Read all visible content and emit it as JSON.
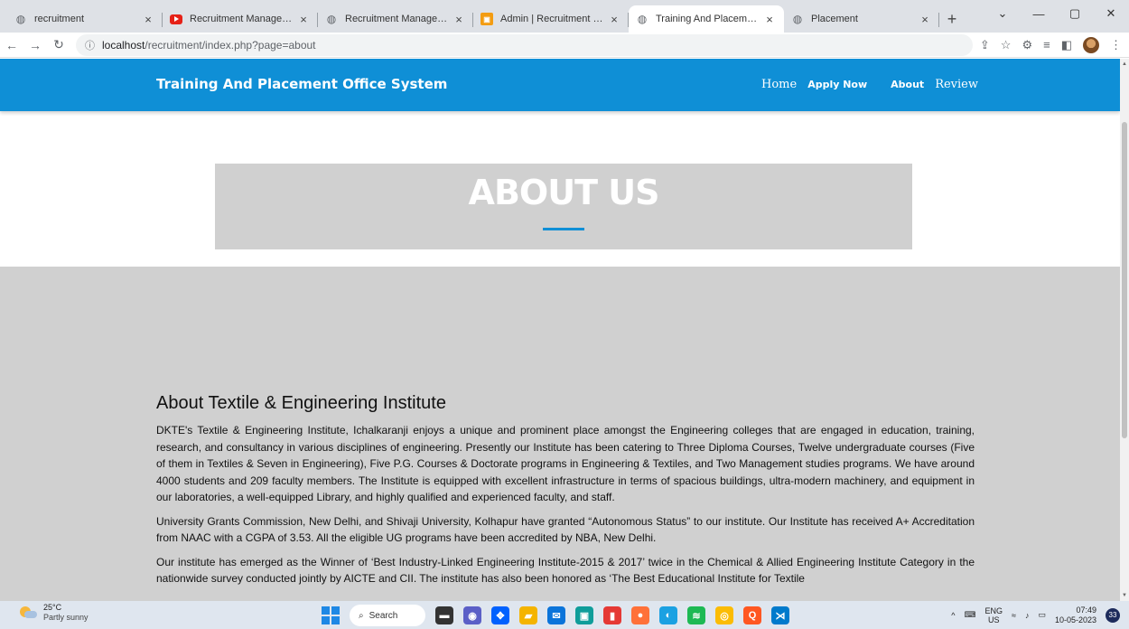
{
  "browser": {
    "tabs": [
      {
        "title": "recruitment",
        "icon": "globe-icon",
        "active": false
      },
      {
        "title": "Recruitment Management Sys",
        "icon": "youtube-icon",
        "active": false
      },
      {
        "title": "Recruitment Management Sys",
        "icon": "globe-icon",
        "active": false
      },
      {
        "title": "Admin | Recruitment Manage",
        "icon": "admin-app-icon",
        "active": false
      },
      {
        "title": "Training And Placement Offic",
        "icon": "globe-icon",
        "active": true
      },
      {
        "title": "Placement",
        "icon": "globe-icon",
        "active": false
      }
    ],
    "close_glyph": "×",
    "new_tab_glyph": "+",
    "url_host": "localhost",
    "url_path": "/recruitment/index.php?page=about"
  },
  "site": {
    "brand": "Training And Placement Office System",
    "nav": {
      "home": "Home",
      "apply": "Apply Now",
      "about": "About",
      "review": "Review"
    },
    "accent_color": "#0f8fd6"
  },
  "hero": {
    "title": "ABOUT US"
  },
  "about": {
    "heading": "About Textile & Engineering Institute",
    "paragraphs": [
      "DKTE's Textile & Engineering Institute, Ichalkaranji enjoys a unique and prominent place amongst the Engineering colleges that are engaged in education, training, research, and consultancy in various disciplines of engineering. Presently our Institute has been catering to Three Diploma Courses, Twelve undergraduate courses (Five of them in Textiles & Seven in Engineering), Five P.G. Courses & Doctorate programs in Engineering & Textiles, and Two Management studies programs. We have around 4000 students and 209 faculty members. The Institute is equipped with excellent infrastructure in terms of spacious buildings, ultra-modern machinery, and equipment in our laboratories, a well-equipped Library, and highly qualified and experienced faculty, and staff.",
      "University Grants Commission, New Delhi, and Shivaji University, Kolhapur have granted “Autonomous Status” to our institute. Our Institute has received A+ Accreditation from NAAC with a CGPA of 3.53.  All the eligible UG programs have been accredited by NBA, New Delhi.",
      "Our institute has emerged as the Winner of ‘Best Industry-Linked Engineering Institute-2015 & 2017’ twice in the Chemical & Allied Engineering Institute Category in the nationwide survey conducted jointly by AICTE and CII. The institute has also been honored as ‘The Best Educational Institute for Textile"
    ]
  },
  "taskbar": {
    "temperature": "25°C",
    "weather": "Partly sunny",
    "search_label": "Search",
    "lang_top": "ENG",
    "lang_bottom": "US",
    "time": "07:49",
    "date": "10-05-2023",
    "notification_count": "33"
  }
}
